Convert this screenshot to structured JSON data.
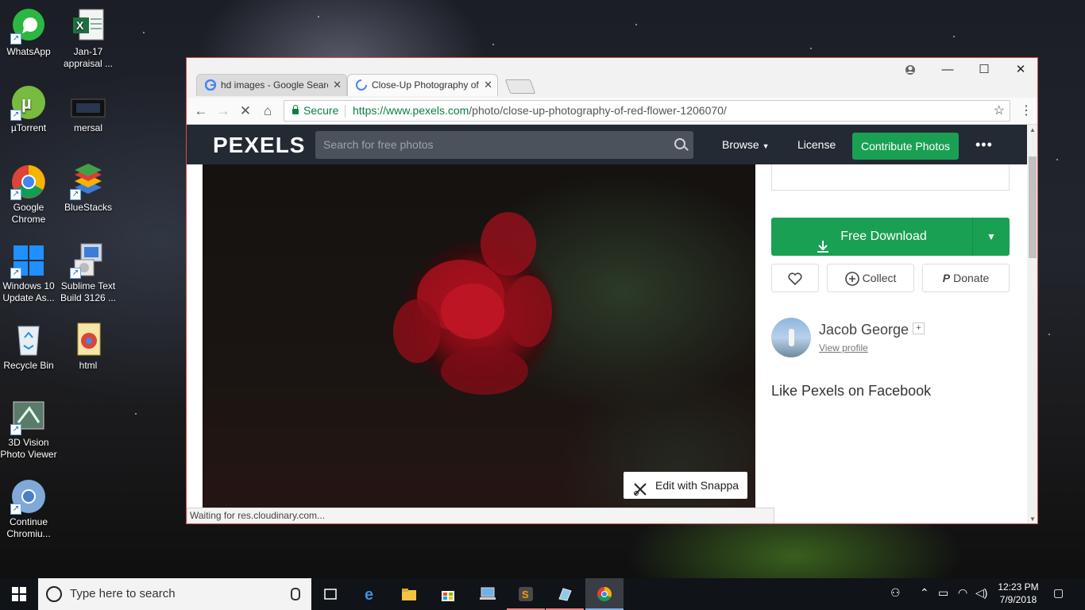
{
  "desktop": {
    "icons": [
      {
        "label": "WhatsApp",
        "icon": "whatsapp-icon"
      },
      {
        "label": "Jan-17 appraisal ...",
        "icon": "excel-file-icon"
      },
      {
        "label": "µTorrent",
        "icon": "utorrent-icon"
      },
      {
        "label": "mersal",
        "icon": "video-file-icon"
      },
      {
        "label": "Google Chrome",
        "icon": "chrome-icon"
      },
      {
        "label": "BlueStacks",
        "icon": "bluestacks-icon"
      },
      {
        "label": "Windows 10 Update As...",
        "icon": "windows-update-icon"
      },
      {
        "label": "Sublime Text Build 3126 ...",
        "icon": "installer-icon"
      },
      {
        "label": "Recycle Bin",
        "icon": "recycle-bin-icon"
      },
      {
        "label": "html",
        "icon": "html-file-icon"
      },
      {
        "label": "3D Vision Photo Viewer",
        "icon": "3d-vision-icon"
      },
      {
        "label": "Continue Chromiu...",
        "icon": "chromium-icon"
      }
    ]
  },
  "browser": {
    "tabs": [
      {
        "title": "hd images - Google Search",
        "active": false
      },
      {
        "title": "Close-Up Photography of Red Flower",
        "active": true
      }
    ],
    "window_controls": {
      "minimize": "—",
      "maximize": "☐",
      "close": "✕"
    },
    "secure_label": "Secure",
    "url_host": "https://www.pexels.com",
    "url_path": "/photo/close-up-photography-of-red-flower-1206070/",
    "status_text": "Waiting for res.cloudinary.com..."
  },
  "pexels": {
    "logo": "PEXELS",
    "search_placeholder": "Search for free photos",
    "nav": {
      "browse": "Browse",
      "license": "License",
      "contribute": "Contribute Photos",
      "more": "•••"
    },
    "edit_button": "Edit with Snappa",
    "download_label": "Free Download",
    "collect_label": "Collect",
    "donate_label": "Donate",
    "author_name": "Jacob George",
    "plus": "+",
    "view_profile": "View profile",
    "facebook_heading": "Like Pexels on Facebook",
    "colors": {
      "header": "#232a34",
      "green": "#1aa053"
    }
  },
  "taskbar": {
    "search_placeholder": "Type here to search",
    "time": "12:23 PM",
    "date": "7/9/2018"
  }
}
